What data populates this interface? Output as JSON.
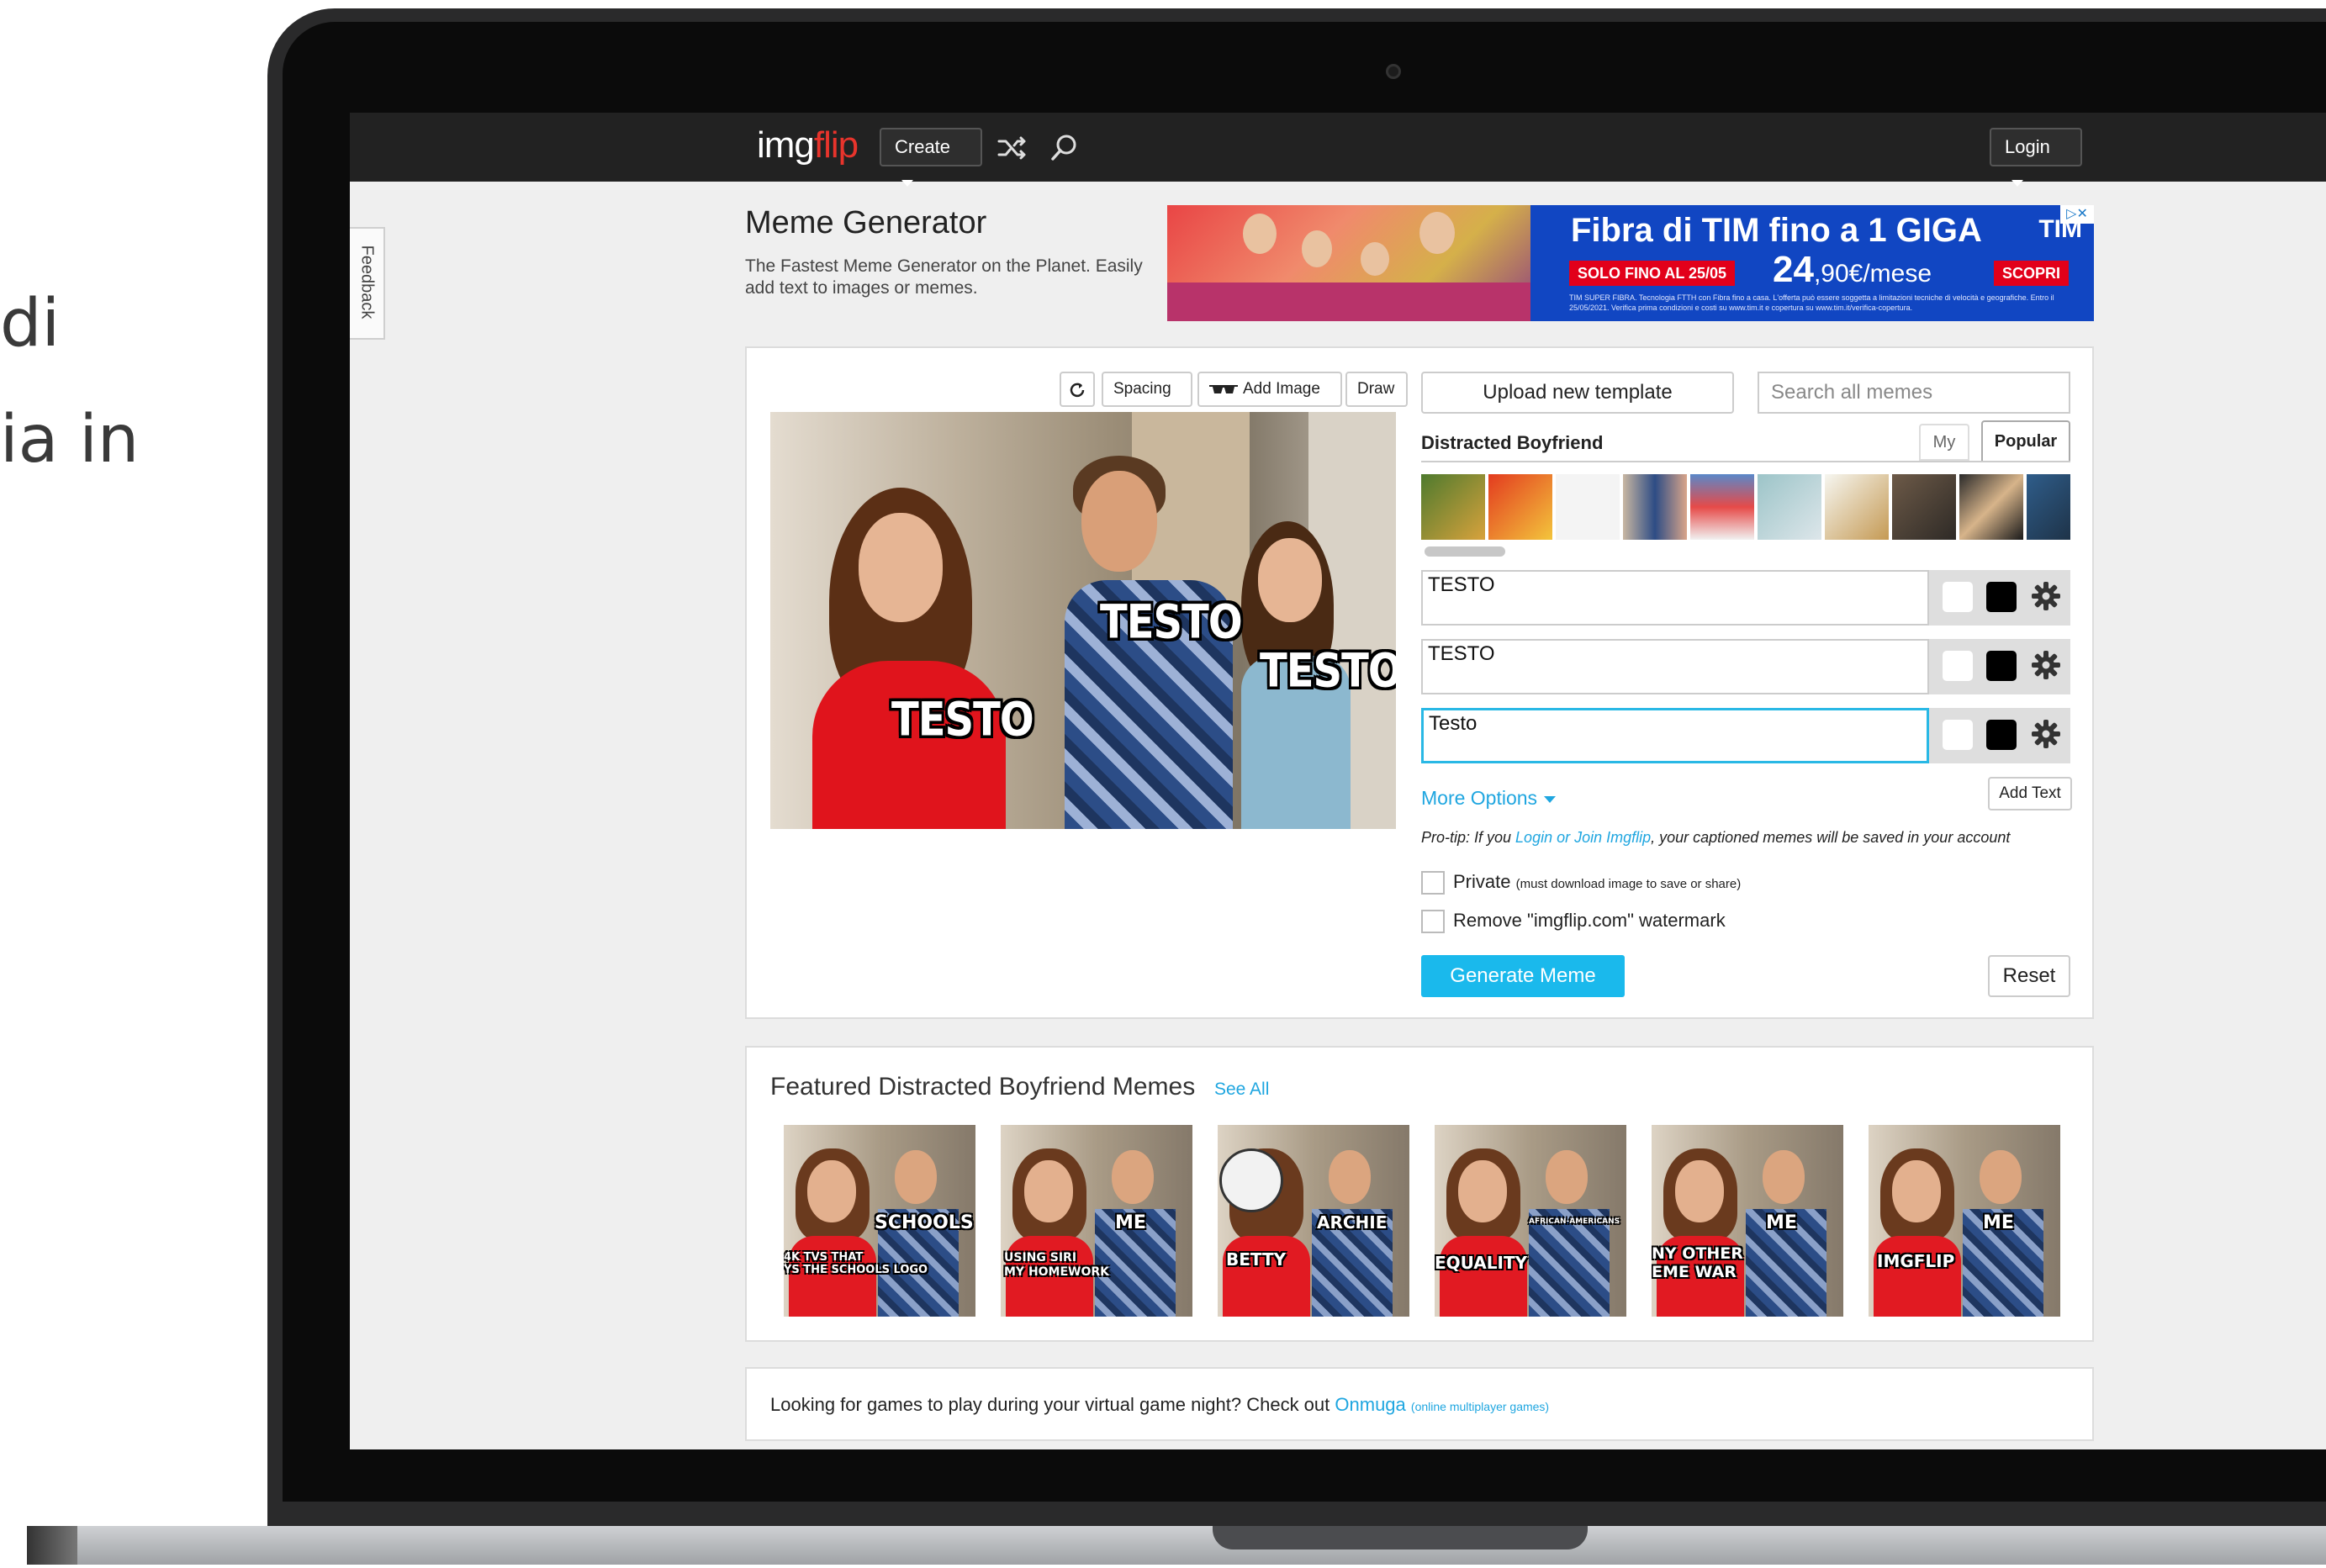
{
  "side_text": {
    "line1": "di",
    "line2": "ia in"
  },
  "header": {
    "logo_left": "img",
    "logo_right": "flip",
    "create_label": "Create",
    "login_label": "Login"
  },
  "feedback_label": "Feedback",
  "page": {
    "title": "Meme Generator",
    "subtitle": "The Fastest Meme Generator on the Planet. Easily add text to images or memes."
  },
  "ad": {
    "headline": "Fibra di TIM fino a 1 GIGA",
    "brand": "TIM",
    "promo": "SOLO FINO AL 25/05",
    "price_big": "24",
    "price_small": ",90€/mese",
    "cta": "SCOPRI",
    "fine_print": "TIM SUPER FIBRA. Tecnologia FTTH con Fibra fino a casa. L'offerta può essere soggetta a limitazioni tecniche di velocità e geografiche. Entro il 25/05/2021. Verifica prima condizioni e costi su www.tim.it e copertura su www.tim.it/verifica-copertura.",
    "close": "▷✕"
  },
  "editor": {
    "toolbar": {
      "spacing": "Spacing",
      "add_image": "Add Image",
      "draw": "Draw"
    },
    "captions": [
      "TESTO",
      "TESTO",
      "TESTO"
    ],
    "upload_label": "Upload new template",
    "search_placeholder": "Search all memes",
    "template_name": "Distracted Boyfriend",
    "tab_my": "My",
    "tab_popular": "Popular",
    "text_boxes": [
      "TESTO",
      "TESTO",
      "Testo"
    ],
    "more_options": "More Options",
    "add_text": "Add Text",
    "protip_prefix": "Pro-tip: If you ",
    "protip_link": "Login or Join Imgflip",
    "protip_suffix": ", your captioned memes will be saved in your account",
    "private_label": "Private",
    "private_note": "(must download image to save or share)",
    "watermark_label": "Remove \"imgflip.com\" watermark",
    "generate_label": "Generate Meme",
    "reset_label": "Reset"
  },
  "featured": {
    "title": "Featured Distracted Boyfriend Memes",
    "see_all": "See All",
    "items": [
      {
        "left": "4K TVS THAT\nYS THE SCHOOLS LOGO",
        "right": "SCHOOLS"
      },
      {
        "left": "USING SIRI\nMY HOMEWORK",
        "right": "ME"
      },
      {
        "left": "BETTY",
        "right": "ARCHIE"
      },
      {
        "left": "EQUALITY",
        "right": "AFRICAN-AMERICANS"
      },
      {
        "left": "NY OTHER\nEME WAR",
        "right": "ME"
      },
      {
        "left": "IMGFLIP",
        "right": "ME"
      }
    ]
  },
  "games": {
    "text": "Looking for games to play during your virtual game night? Check out ",
    "link": "Onmuga",
    "note": "(online multiplayer games)"
  },
  "colors": {
    "accent": "#1ab9ec",
    "logo_red": "#e8342c",
    "topbar": "#222222",
    "ad_blue": "#1146c2",
    "ad_red": "#e2001a"
  }
}
